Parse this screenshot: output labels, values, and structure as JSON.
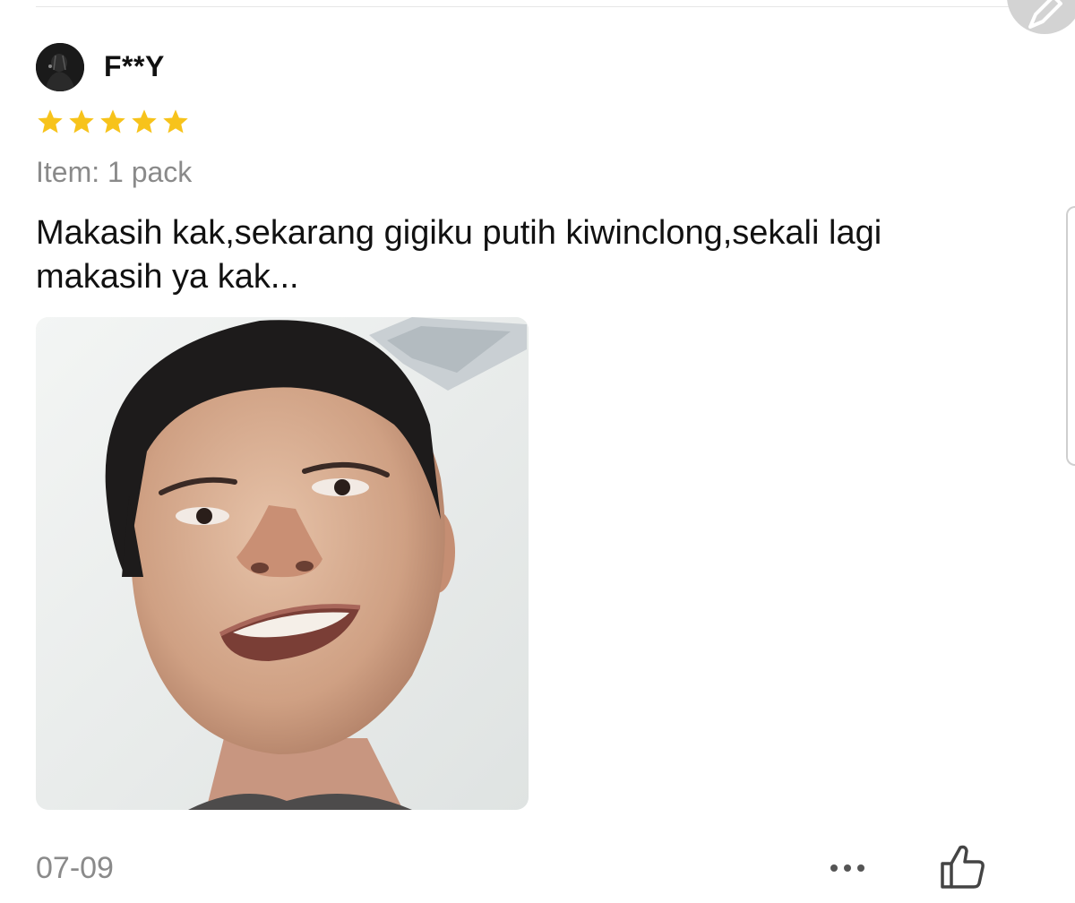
{
  "review": {
    "username": "F**Y",
    "rating": 5,
    "rating_max": 5,
    "variation": "Item: 1 pack",
    "text": "Makasih kak,sekarang gigiku putih kiwinclong,sekali lagi makasih ya kak...",
    "date": "07-09"
  },
  "icons": {
    "edit": "pencil-icon",
    "star": "star-icon",
    "more": "more-dots-icon",
    "like": "thumbs-up-icon"
  },
  "colors": {
    "star": "#F7C31B",
    "muted_text": "#8a8a8a",
    "body_text": "#111111"
  }
}
